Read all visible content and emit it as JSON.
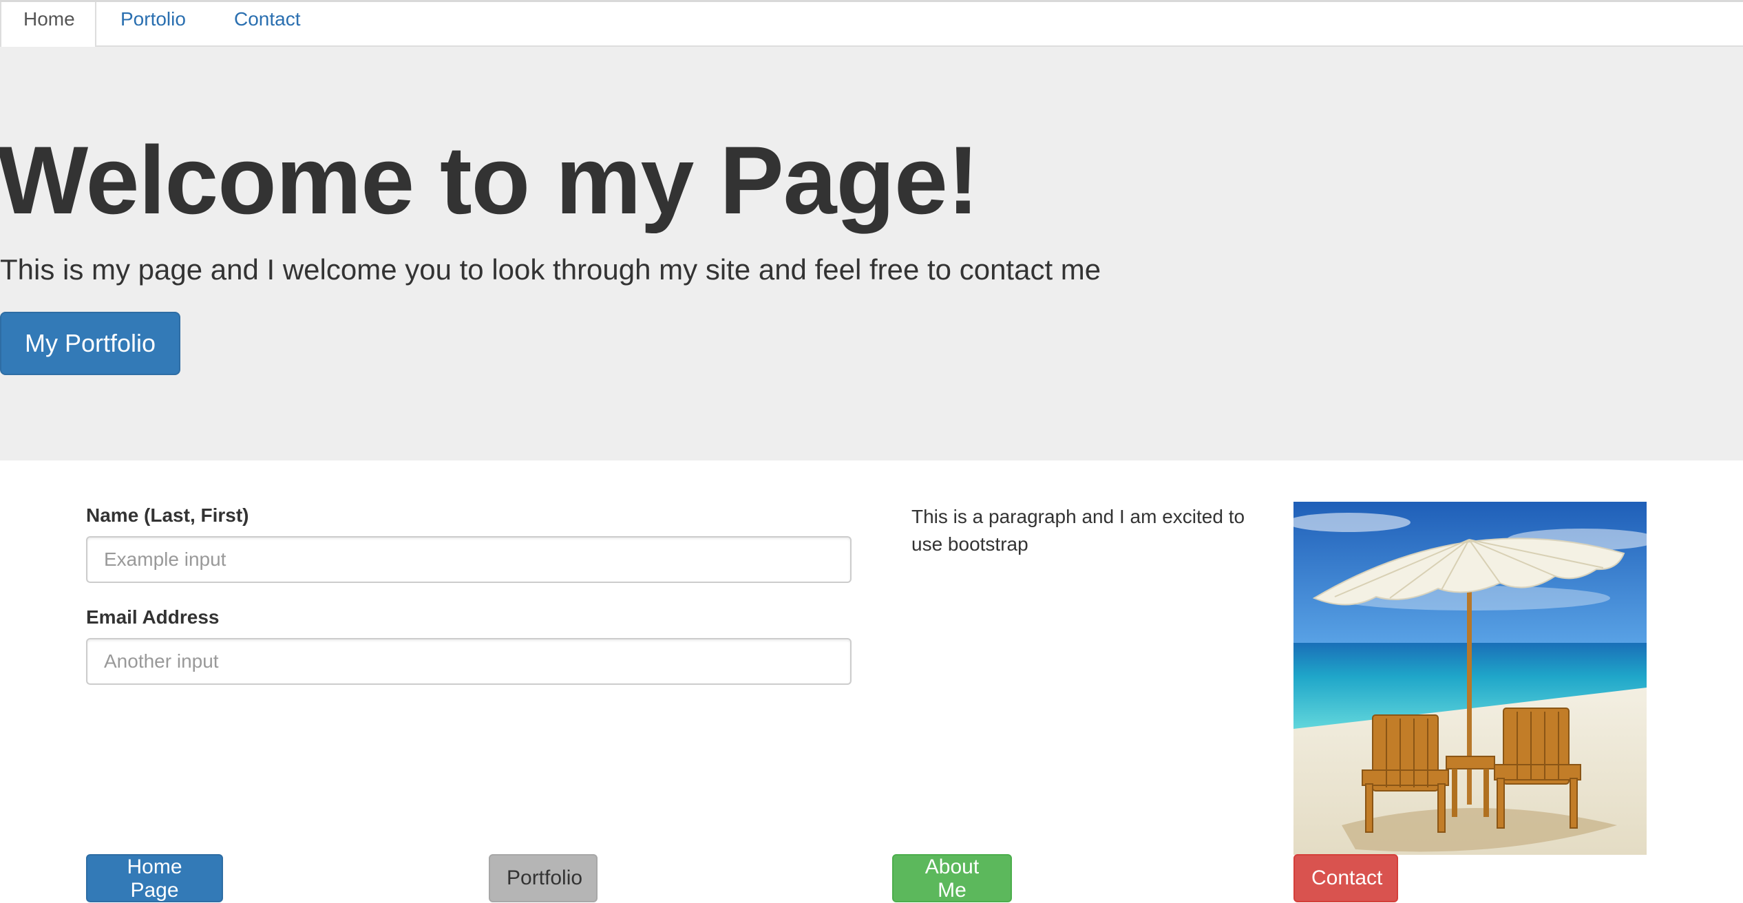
{
  "nav": {
    "tabs": [
      {
        "label": "Home",
        "active": true
      },
      {
        "label": "Portolio",
        "active": false
      },
      {
        "label": "Contact",
        "active": false
      }
    ]
  },
  "hero": {
    "title": "Welcome to my Page!",
    "text": "This is my page and I welcome you to look through my site and feel free to contact me",
    "button_label": "My Portfolio"
  },
  "form": {
    "name_label": "Name (Last, First)",
    "name_placeholder": "Example input",
    "name_value": "",
    "email_label": "Email Address",
    "email_placeholder": "Another input",
    "email_value": ""
  },
  "content": {
    "paragraph": "This is a paragraph and I am excited to use bootstrap"
  },
  "bottom_buttons": {
    "home": "Home Page",
    "portfolio": "Portfolio",
    "about": "About Me",
    "contact": "Contact"
  },
  "colors": {
    "primary": "#337ab7",
    "link": "#2a6fb0",
    "hero_bg": "#eeeeee",
    "default_btn": "#b5b5b5",
    "success": "#5cb85c",
    "danger": "#d9534f"
  }
}
